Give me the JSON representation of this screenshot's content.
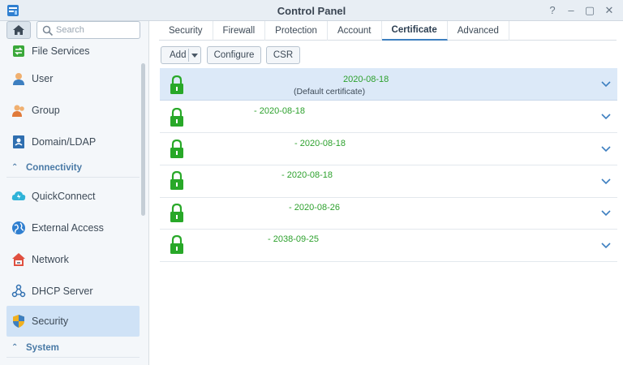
{
  "window": {
    "title": "Control Panel",
    "buttons": [
      "?",
      "–",
      "▢",
      "✕"
    ]
  },
  "sidebar": {
    "search_placeholder": "Search",
    "items": [
      {
        "label": "File Services",
        "icon": "file-services-icon"
      },
      {
        "label": "User",
        "icon": "user-icon"
      },
      {
        "label": "Group",
        "icon": "group-icon"
      },
      {
        "label": "Domain/LDAP",
        "icon": "domain-ldap-icon"
      }
    ],
    "section_connectivity": "Connectivity",
    "connectivity_items": [
      {
        "label": "QuickConnect",
        "icon": "quickconnect-icon"
      },
      {
        "label": "External Access",
        "icon": "globe-icon"
      },
      {
        "label": "Network",
        "icon": "network-icon"
      },
      {
        "label": "DHCP Server",
        "icon": "dhcp-icon"
      },
      {
        "label": "Security",
        "icon": "shield-icon",
        "active": true
      }
    ],
    "section_system": "System"
  },
  "tabs": [
    "Security",
    "Firewall",
    "Protection",
    "Account",
    "Certificate",
    "Advanced"
  ],
  "active_tab": "Certificate",
  "toolbar": {
    "add": "Add",
    "configure": "Configure",
    "csr": "CSR"
  },
  "certificates": [
    {
      "date": "2020-08-18",
      "subtitle": "(Default certificate)",
      "selected": true
    },
    {
      "date": "- 2020-08-18",
      "subtitle": ""
    },
    {
      "date": "- 2020-08-18",
      "subtitle": ""
    },
    {
      "date": "- 2020-08-18",
      "subtitle": ""
    },
    {
      "date": "- 2020-08-26",
      "subtitle": ""
    },
    {
      "date": "- 2038-09-25",
      "subtitle": ""
    }
  ],
  "colors": {
    "accent": "#3d7fc0",
    "valid_green": "#2da12d",
    "selected_row": "#dce9f8"
  }
}
